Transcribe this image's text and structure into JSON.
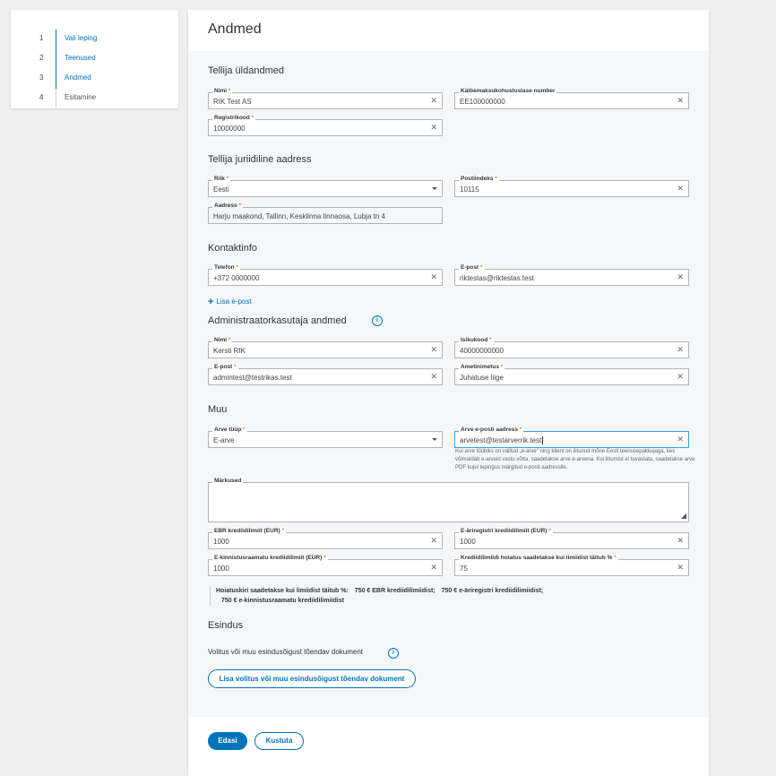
{
  "steps": [
    {
      "num": "1",
      "label": "Vali leping",
      "state": "done"
    },
    {
      "num": "2",
      "label": "Teenused",
      "state": "done"
    },
    {
      "num": "3",
      "label": "Andmed",
      "state": "done"
    },
    {
      "num": "4",
      "label": "Esitamine",
      "state": "todo"
    }
  ],
  "page_title": "Andmed",
  "sections": {
    "general": "Tellija üldandmed",
    "address": "Tellija juriidiline aadress",
    "contact": "Kontaktinfo",
    "admin": "Administraatorkasutaja andmed",
    "other": "Muu",
    "representation": "Esindus"
  },
  "general": {
    "name": {
      "label": "Nimi",
      "value": "RIK Test AS"
    },
    "vat": {
      "label": "Käibemaksukohustuslase number",
      "value": "EE100000000"
    },
    "regcode": {
      "label": "Registrikood",
      "value": "10000000"
    }
  },
  "address": {
    "country": {
      "label": "Riik",
      "value": "Eesti"
    },
    "postal": {
      "label": "Postiindeks",
      "value": "10115"
    },
    "addr": {
      "label": "Aadress",
      "value": "Harju maakond, Tallinn, Kesklinna linnaosa, Lubja tn 4"
    }
  },
  "contact": {
    "phone": {
      "label": "Telefon",
      "value": "+372 0000000"
    },
    "email": {
      "label": "E-post",
      "value": "riktestas@riktestas.test"
    },
    "add_email": "Lisa e-post"
  },
  "admin": {
    "name": {
      "label": "Nimi",
      "value": "Kersti RIK"
    },
    "idcode": {
      "label": "Isikukood",
      "value": "40000000000"
    },
    "email": {
      "label": "E-post",
      "value": "admintest@testrikas.test"
    },
    "position": {
      "label": "Ametinimetus",
      "value": "Juhatuse liige"
    }
  },
  "other": {
    "invoice_type": {
      "label": "Arve tüüp",
      "value": "E-arve"
    },
    "invoice_email": {
      "label": "Arve e-posti aadress",
      "value": "arvetest@testarverrik.test"
    },
    "invoice_help": "Kui arve tüübiks on valitud „e-arve\" ning klient on liitunud mõne Eesti teenusepakkujaga, kes võimaldab e-arveid vastu võtta, saadetakse arve e-arvena. Kui liitumist ei tuvastata, saadetakse arve PDF kujul lepingus märgitud e-posti aadressile.",
    "notes": {
      "label": "Märkused",
      "value": ""
    },
    "ebr_limit": {
      "label": "EBR krediidilimiit (EUR)",
      "value": "1000"
    },
    "ear_limit": {
      "label": "E-äriregistri krediidilimiit (EUR)",
      "value": "1000"
    },
    "ekr_limit": {
      "label": "E-kinnistusraamatu krediidilimiit (EUR)",
      "value": "1000"
    },
    "warn_pct": {
      "label": "Krediidilimiidi hoiatus saadetakse kui limiidist täitub %",
      "value": "75"
    },
    "warning_note": {
      "lead": "Hoiatuskiri saadetakse kui limiidist täitub %:",
      "ebr": "750 € EBR krediidilimiidist;",
      "ear": "750 € e-äriregistri krediidilimiidist;",
      "ekr": "750 € e-kinnistusraamatu krediidilimiidist"
    }
  },
  "representation": {
    "doc_label": "Volitus või muu esindusõigust tõendav dokument",
    "add_doc_button": "Lisa volitus või muu esindusõigust tõendav dokument"
  },
  "footer": {
    "next": "Edasi",
    "delete": "Kustuta"
  },
  "colors": {
    "accent": "#0074b8",
    "required": "#e07a2b",
    "card_bg": "#f4f6f8"
  },
  "icons": {
    "clear": "close-icon",
    "dropdown": "chevron-down-icon",
    "info": "info-icon",
    "add": "plus-icon"
  }
}
